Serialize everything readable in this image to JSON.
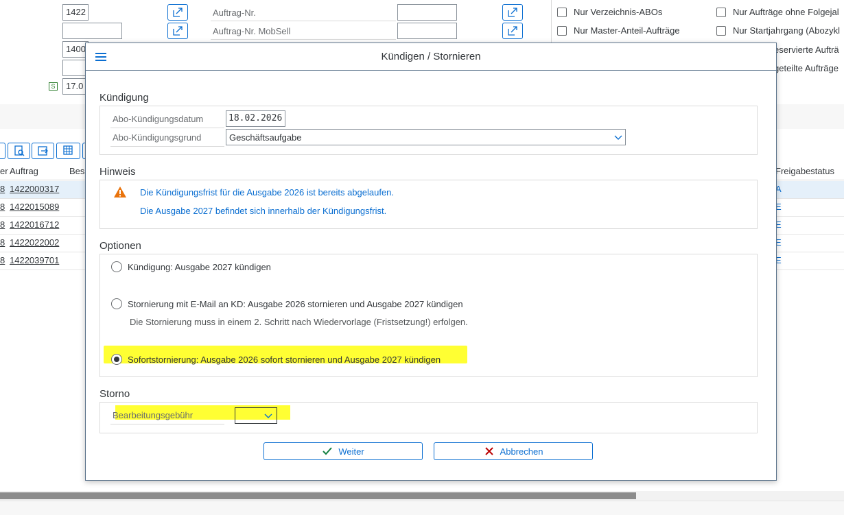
{
  "background": {
    "fields": {
      "row1_value": "1422",
      "row3_value": "1400",
      "row5_value": "17.0",
      "auftrag_nr_label": "Auftrag-Nr.",
      "auftrag_nr_mobsell_label": "Auftrag-Nr. MobSell",
      "s_icon": "S"
    },
    "checkboxes": [
      "Nur Verzeichnis-ABOs",
      "Nur Aufträge ohne Folgejal",
      "Nur Master-Anteil-Aufträge",
      "Nur Startjahrgang (Abozykl",
      "eservierte Aufträ",
      "geteilte Aufträge"
    ],
    "table": {
      "headers": [
        "er",
        "Auftrag",
        "Bes",
        "Freigabestatus"
      ],
      "rows": [
        {
          "prefix": "8",
          "auftrag": "1422000317",
          "status": "A"
        },
        {
          "prefix": "8",
          "auftrag": "1422015089",
          "status": "E"
        },
        {
          "prefix": "8",
          "auftrag": "1422016712",
          "status": "E"
        },
        {
          "prefix": "8",
          "auftrag": "1422022002",
          "status": "E"
        },
        {
          "prefix": "8",
          "auftrag": "1422039701",
          "status": "E"
        }
      ]
    }
  },
  "dialog": {
    "title": "Kündigen / Stornieren",
    "kuendigung": {
      "title": "Kündigung",
      "datum_label": "Abo-Kündigungsdatum",
      "datum_value": "18.02.2026",
      "grund_label": "Abo-Kündigungsgrund",
      "grund_value": "Geschäftsaufgabe"
    },
    "hinweis": {
      "title": "Hinweis",
      "line1": "Die Kündigungsfrist für die Ausgabe 2026 ist bereits abgelaufen.",
      "line2": "Die Ausgabe 2027 befindet sich innerhalb der Kündigungsfrist."
    },
    "optionen": {
      "title": "Optionen",
      "options": [
        {
          "label": "Kündigung: Ausgabe 2027 kündigen",
          "selected": false
        },
        {
          "label": "Stornierung mit E-Mail an KD: Ausgabe 2026 stornieren und Ausgabe 2027 kündigen",
          "selected": false,
          "note": "Die Stornierung muss in einem 2. Schritt nach Wiedervorlage (Fristsetzung!) erfolgen."
        },
        {
          "label": "Sofortstornierung: Ausgabe 2026 sofort stornieren und Ausgabe 2027 kündigen",
          "selected": true
        }
      ]
    },
    "storno": {
      "title": "Storno",
      "gebuehr_label": "Bearbeitungsgebühr",
      "gebuehr_value": ""
    },
    "buttons": {
      "weiter": "Weiter",
      "abbrechen": "Abbrechen"
    }
  },
  "colors": {
    "accent": "#0a6ed1",
    "highlight": "#ffff33",
    "warning": "#e9730c",
    "success": "#107e3e",
    "error": "#bb0000"
  }
}
